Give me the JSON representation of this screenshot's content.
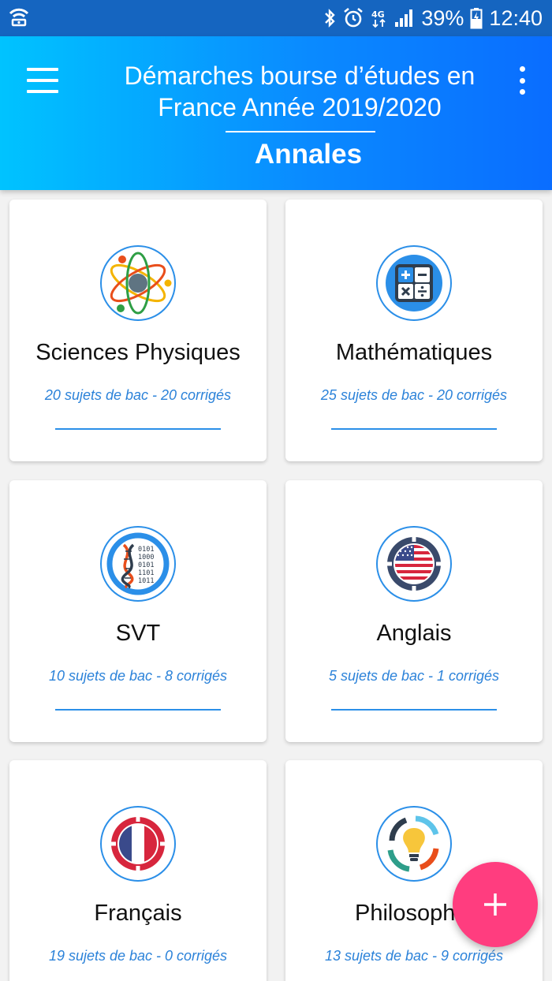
{
  "status_bar": {
    "battery": "39%",
    "time": "12:40",
    "icons": [
      "wifi-hotspot-icon",
      "bluetooth-icon",
      "alarm-icon",
      "4g-icon",
      "signal-icon",
      "battery-icon"
    ]
  },
  "app_bar": {
    "title": "Démarches bourse d’études en France Année 2019/2020",
    "subtitle": "Annales",
    "menu_icon": "hamburger-menu-icon",
    "overflow_icon": "more-vert-icon",
    "gradient": [
      "#00c3ff",
      "#0a6dff"
    ]
  },
  "subjects": [
    {
      "title": "Sciences Physiques",
      "stats": "20 sujets de bac - 20 corrigés",
      "icon": "atom-icon"
    },
    {
      "title": "Mathématiques",
      "stats": "25 sujets de bac - 20 corrigés",
      "icon": "calculator-icon"
    },
    {
      "title": "SVT",
      "stats": "10 sujets de bac - 8 corrigés",
      "icon": "dna-icon"
    },
    {
      "title": "Anglais",
      "stats": "5 sujets de bac - 1 corrigés",
      "icon": "us-flag-icon"
    },
    {
      "title": "Français",
      "stats": "19 sujets de bac - 0 corrigés",
      "icon": "french-flag-icon"
    },
    {
      "title": "Philosophie",
      "stats": "13 sujets de bac - 9 corrigés",
      "icon": "lightbulb-icon"
    }
  ],
  "fab": {
    "label": "+",
    "icon": "add-icon",
    "color": "#ff3d7f"
  },
  "colors": {
    "accent": "#2b8fe8",
    "stats_text": "#2b82d9",
    "status_bar": "#1565c0"
  }
}
